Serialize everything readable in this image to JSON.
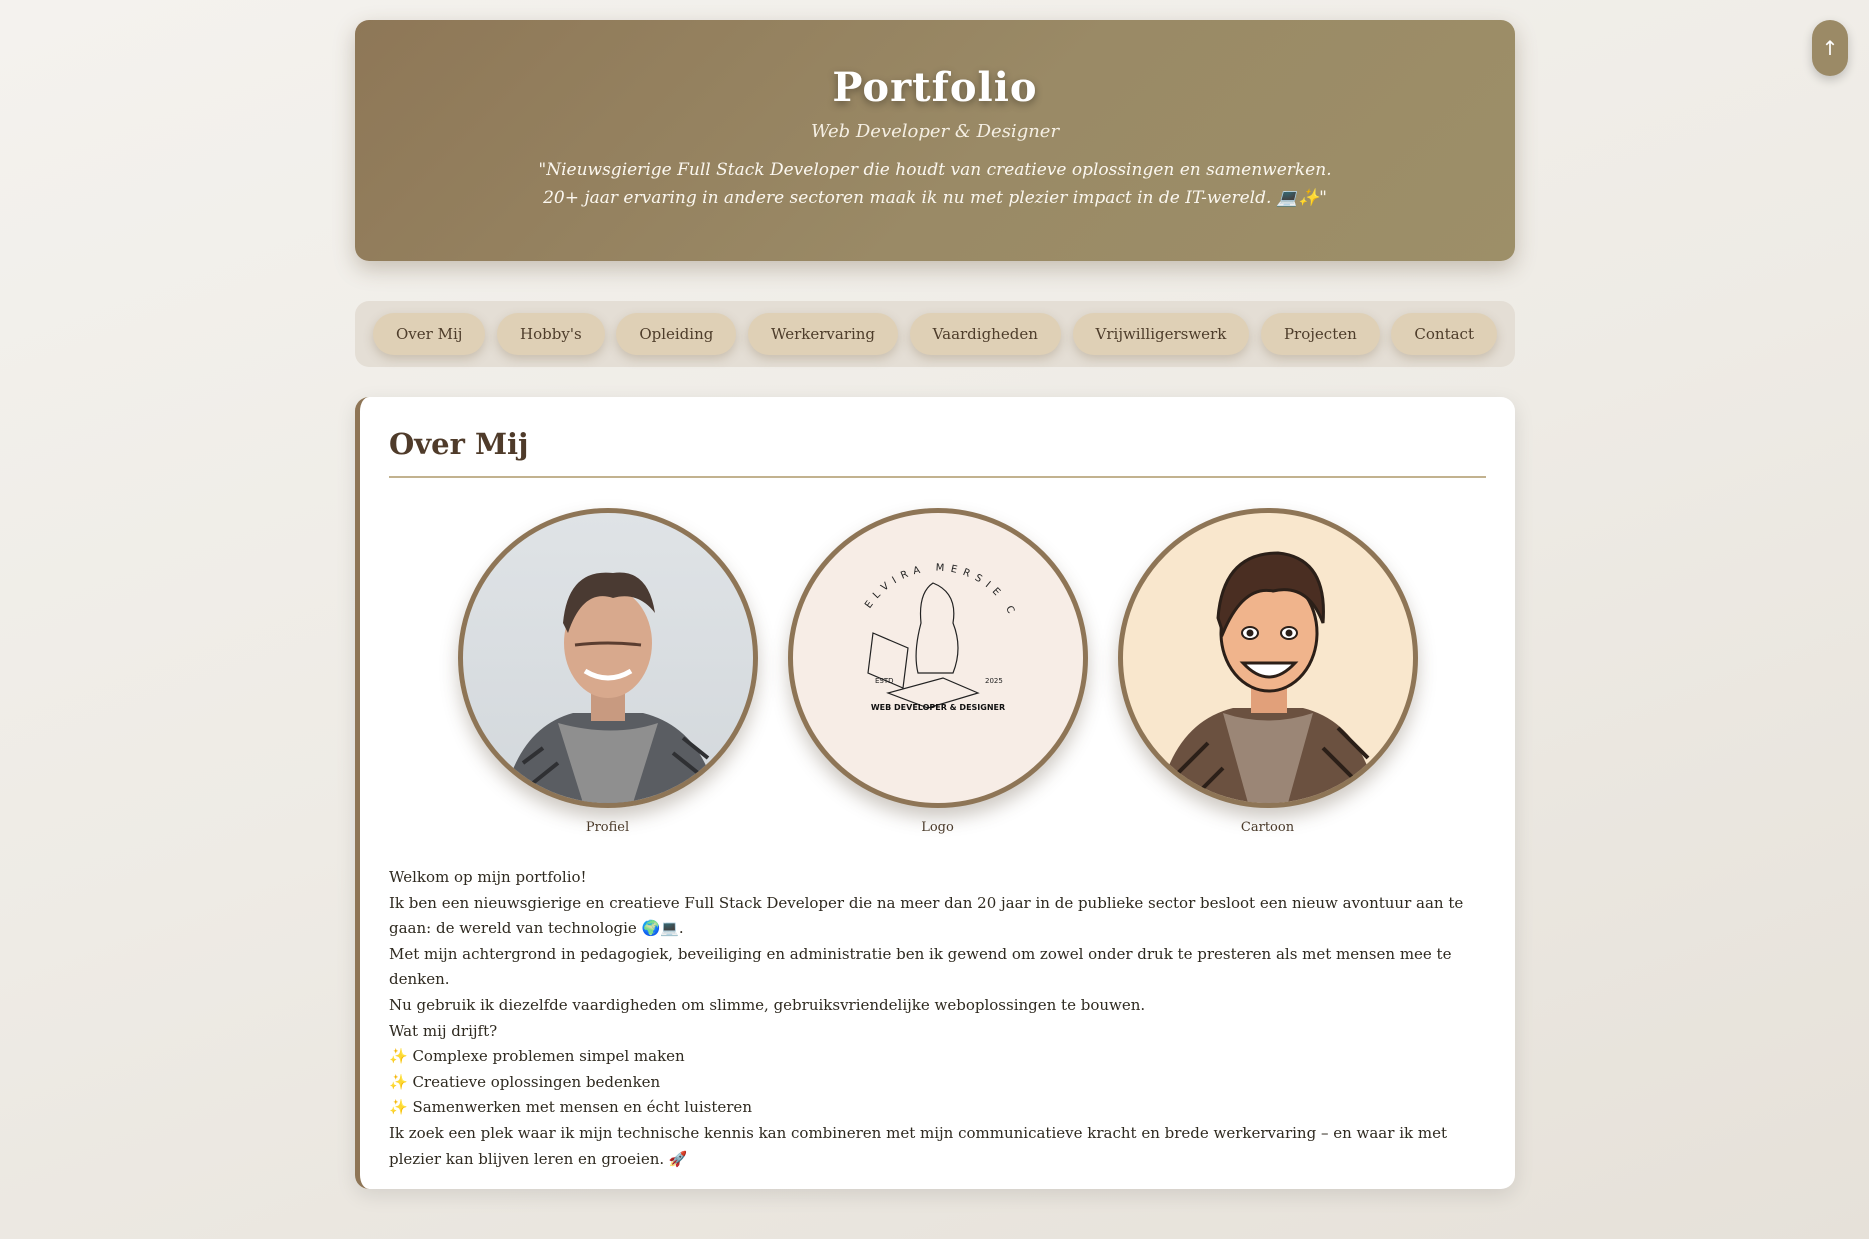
{
  "header": {
    "title": "Portfolio",
    "subtitle": "Web Developer & Designer",
    "quote_line1": "\"Nieuwsgierige Full Stack Developer die houdt van creatieve oplossingen en samenwerken.",
    "quote_line2": "20+ jaar ervaring in andere sectoren maak ik nu met plezier impact in de IT-wereld. 💻✨\""
  },
  "nav": {
    "items": [
      "Over Mij",
      "Hobby's",
      "Opleiding",
      "Werkervaring",
      "Vaardigheden",
      "Vrijwilligerswerk",
      "Projecten",
      "Contact"
    ]
  },
  "about": {
    "heading": "Over Mij",
    "images": [
      {
        "caption": "Profiel"
      },
      {
        "caption": "Logo",
        "logo_arc_text": "ELVIRA MERSIE CID",
        "logo_estd": "ESTD",
        "logo_year": "2025",
        "logo_tagline": "WEB DEVELOPER & DESIGNER"
      },
      {
        "caption": "Cartoon"
      }
    ],
    "paragraphs": [
      "Welkom op mijn portfolio!",
      "Ik ben een nieuwsgierige en creatieve Full Stack Developer die na meer dan 20 jaar in de publieke sector besloot een nieuw avontuur aan te gaan: de wereld van technologie 🌍💻.",
      "Met mijn achtergrond in pedagogiek, beveiliging en administratie ben ik gewend om zowel onder druk te presteren als met mensen mee te denken.",
      "Nu gebruik ik diezelfde vaardigheden om slimme, gebruiksvriendelijke weboplossingen te bouwen.",
      "Wat mij drijft?",
      "✨ Complexe problemen simpel maken",
      "✨ Creatieve oplossingen bedenken",
      "✨ Samenwerken met mensen en écht luisteren",
      "Ik zoek een plek waar ik mijn technische kennis kan combineren met mijn communicatieve kracht en brede werkervaring – en waar ik met plezier kan blijven leren en groeien. 🚀"
    ]
  },
  "scroll_top": {
    "label": "↑"
  },
  "colors": {
    "accent": "#8e7556",
    "header": "#9a8a66",
    "nav_button": "#dfd0b6"
  }
}
